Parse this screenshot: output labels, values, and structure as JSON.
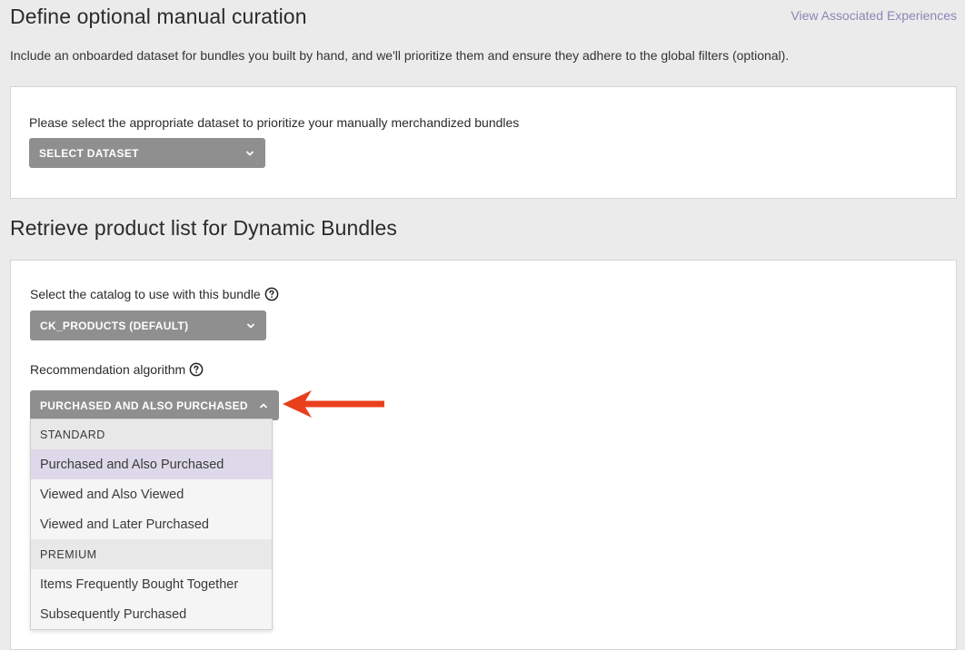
{
  "section1": {
    "title": "Define optional manual curation",
    "link": "View Associated Experiences",
    "description": "Include an onboarded dataset for bundles you built by hand, and we'll prioritize them and ensure they adhere to the global filters (optional).",
    "dataset_label": "Please select the appropriate dataset to prioritize your manually merchandized bundles",
    "dataset_select": "SELECT DATASET"
  },
  "section2": {
    "title": "Retrieve product list for Dynamic Bundles",
    "catalog_label": "Select the catalog to use with this bundle",
    "catalog_select": "CK_PRODUCTS (DEFAULT)",
    "algorithm_label": "Recommendation algorithm",
    "algorithm_select": "PURCHASED AND ALSO PURCHASED",
    "menu": {
      "group_standard": "STANDARD",
      "standard_items": [
        "Purchased and Also Purchased",
        "Viewed and Also Viewed",
        "Viewed and Later Purchased"
      ],
      "group_premium": "PREMIUM",
      "premium_items": [
        "Items Frequently Bought Together",
        "Subsequently Purchased"
      ],
      "selected_item": "Purchased and Also Purchased"
    }
  },
  "icons": {
    "help": "question-circle-icon",
    "chevron_down": "chevron-down-icon",
    "chevron_up": "chevron-up-icon",
    "annotation_arrow": "red-arrow-left"
  },
  "colors": {
    "page_bg": "#ebebeb",
    "card_bg": "#ffffff",
    "select_bg": "#8f8f8f",
    "link": "#8a86b8",
    "selected_item_bg": "#ddd9ea",
    "arrow": "#e8401c"
  }
}
